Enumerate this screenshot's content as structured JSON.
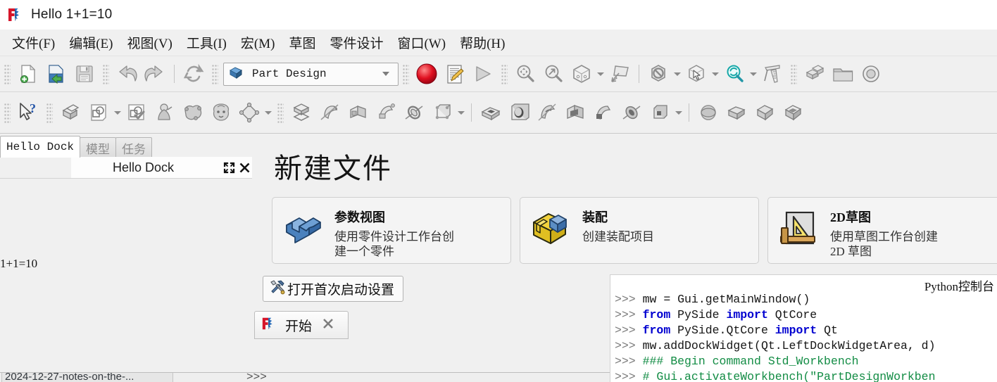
{
  "window": {
    "title": "Hello 1+1=10",
    "logo_icon": "freecad-logo-icon"
  },
  "menubar": {
    "items": [
      {
        "label": "文件(F)",
        "pre": "文件(",
        "key": "F",
        "post": ")"
      },
      {
        "label": "编辑(E)",
        "pre": "编辑(",
        "key": "E",
        "post": ")"
      },
      {
        "label": "视图(V)",
        "pre": "视图(",
        "key": "V",
        "post": ")"
      },
      {
        "label": "工具(I)",
        "pre": "工具(",
        "key": "I",
        "post": ")"
      },
      {
        "label": "宏(M)",
        "pre": "宏(",
        "key": "M",
        "post": ")"
      },
      {
        "label": "草图",
        "pre": "草图",
        "key": "",
        "post": ""
      },
      {
        "label": "零件设计",
        "pre": "零件设计",
        "key": "",
        "post": ""
      },
      {
        "label": "窗口(W)",
        "pre": "窗口(",
        "key": "W",
        "post": ")"
      },
      {
        "label": "帮助(H)",
        "pre": "帮助(",
        "key": "H",
        "post": ")"
      }
    ]
  },
  "toolbar1": {
    "workbench_selector": {
      "value": "Part Design",
      "icon": "partdesign-workbench-icon",
      "caret": "chevron-down-icon"
    },
    "buttons": [
      {
        "name": "new-document-icon"
      },
      {
        "name": "open-document-icon"
      },
      {
        "name": "save-document-icon"
      },
      {
        "name": "undo-icon"
      },
      {
        "name": "redo-icon"
      },
      {
        "name": "refresh-icon"
      },
      {
        "name": "macro-record-icon"
      },
      {
        "name": "macro-edit-icon"
      },
      {
        "name": "macro-execute-icon"
      },
      {
        "name": "fit-all-icon"
      },
      {
        "name": "fit-selection-icon"
      },
      {
        "name": "axonometric-view-icon"
      },
      {
        "name": "draw-style-icon"
      },
      {
        "name": "selection-view-icon"
      },
      {
        "name": "box-selection-icon"
      },
      {
        "name": "clipping-plane-icon"
      },
      {
        "name": "measure-icon"
      },
      {
        "name": "create-part-icon"
      },
      {
        "name": "create-group-icon"
      },
      {
        "name": "create-body-icon"
      }
    ]
  },
  "toolbar2": {
    "buttons": [
      {
        "name": "whats-this-icon"
      },
      {
        "name": "create-body-icon"
      },
      {
        "name": "create-sketch-icon"
      },
      {
        "name": "validate-sketch-icon"
      },
      {
        "name": "create-point-icon"
      },
      {
        "name": "create-shapebinder-icon"
      },
      {
        "name": "create-subshapebinder-icon"
      },
      {
        "name": "create-datum-plane-icon"
      },
      {
        "name": "pad-icon"
      },
      {
        "name": "revolution-icon"
      },
      {
        "name": "additive-loft-icon"
      },
      {
        "name": "additive-pipe-icon"
      },
      {
        "name": "additive-helix-icon"
      },
      {
        "name": "additive-primitive-icon"
      },
      {
        "name": "pocket-icon"
      },
      {
        "name": "hole-icon"
      },
      {
        "name": "groove-icon"
      },
      {
        "name": "subtractive-loft-icon"
      },
      {
        "name": "subtractive-pipe-icon"
      },
      {
        "name": "subtractive-helix-icon"
      },
      {
        "name": "subtractive-primitive-icon"
      },
      {
        "name": "fillet-icon"
      },
      {
        "name": "chamfer-icon"
      },
      {
        "name": "draft-icon"
      },
      {
        "name": "thickness-icon"
      }
    ]
  },
  "dock": {
    "tabs": [
      {
        "label": "Hello Dock",
        "active": true
      },
      {
        "label": "模型",
        "active": false
      },
      {
        "label": "任务",
        "active": false
      }
    ],
    "title": "Hello Dock",
    "float_icon": "float-restore-icon",
    "close_icon": "close-icon",
    "content_text": "1+1=10"
  },
  "start_page": {
    "title": "新建文件",
    "cards": [
      {
        "icon": "part-design-card-icon",
        "heading": "参数视图",
        "description": "使用零件设计工作台创\n建一个零件"
      },
      {
        "icon": "assembly-card-icon",
        "heading": "装配",
        "description": "创建装配项目"
      },
      {
        "icon": "sketch-2d-card-icon",
        "heading": "2D草图",
        "description": "使用草图工作台创建\n2D 草图"
      }
    ],
    "settings_button": {
      "label": "打开首次启动设置",
      "icon": "tools-wrench-screwdriver-icon"
    },
    "document_tab": {
      "label": "开始",
      "icon": "freecad-logo-icon",
      "close_icon": "close-icon"
    }
  },
  "python_console": {
    "title": "Python控制台",
    "lines": [
      {
        "prompt": ">>>",
        "segments": [
          {
            "t": " mw = Gui.getMainWindow()",
            "c": "tx"
          }
        ]
      },
      {
        "prompt": ">>>",
        "segments": [
          {
            "t": " ",
            "c": "tx"
          },
          {
            "t": "from",
            "c": "kw"
          },
          {
            "t": " PySide ",
            "c": "tx"
          },
          {
            "t": "import",
            "c": "kw"
          },
          {
            "t": " QtCore",
            "c": "tx"
          }
        ]
      },
      {
        "prompt": ">>>",
        "segments": [
          {
            "t": " ",
            "c": "tx"
          },
          {
            "t": "from",
            "c": "kw"
          },
          {
            "t": " PySide.QtCore ",
            "c": "tx"
          },
          {
            "t": "import",
            "c": "kw"
          },
          {
            "t": " Qt",
            "c": "tx"
          }
        ]
      },
      {
        "prompt": ">>>",
        "segments": [
          {
            "t": " mw.addDockWidget(Qt.LeftDockWidgetArea, d)",
            "c": "tx"
          }
        ]
      },
      {
        "prompt": ">>>",
        "segments": [
          {
            "t": " ### Begin command Std_Workbench",
            "c": "cm"
          }
        ]
      },
      {
        "prompt": ">>>",
        "segments": [
          {
            "t": " # Gui.activateWorkbench(\"PartDesignWorkben",
            "c": "cm"
          }
        ]
      }
    ]
  },
  "taskbar": {
    "item_label": "2024-12-27-notes-on-the-...",
    "dots": ">>>"
  },
  "colors": {
    "window_bg": "#f0f0f0",
    "titlebar_bg": "#ffffff",
    "console_bg": "#ffffff",
    "accent_red": "#d6152a",
    "accent_blue": "#2a6ebb",
    "keyword_blue": "#0000d0",
    "comment_green": "#128c44",
    "record_red": "#cf1020"
  }
}
